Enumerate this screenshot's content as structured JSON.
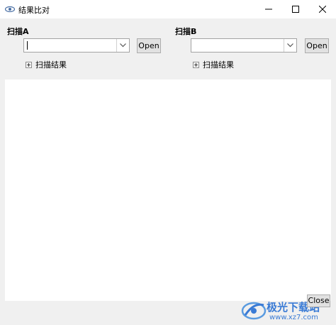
{
  "window": {
    "title": "结果比对",
    "icon": "eye-icon",
    "controls": [
      "minimize-icon",
      "maximize-icon",
      "close-icon"
    ]
  },
  "scan_a": {
    "label": "扫描A",
    "input_value": "",
    "open_label": "Open",
    "results_label": "扫描结果"
  },
  "scan_b": {
    "label": "扫描B",
    "input_value": "",
    "open_label": "Open",
    "results_label": "扫描结果"
  },
  "footer": {
    "close_label": "Close"
  },
  "watermark": {
    "text": "极光下载站",
    "url": "www.xz7.com"
  }
}
